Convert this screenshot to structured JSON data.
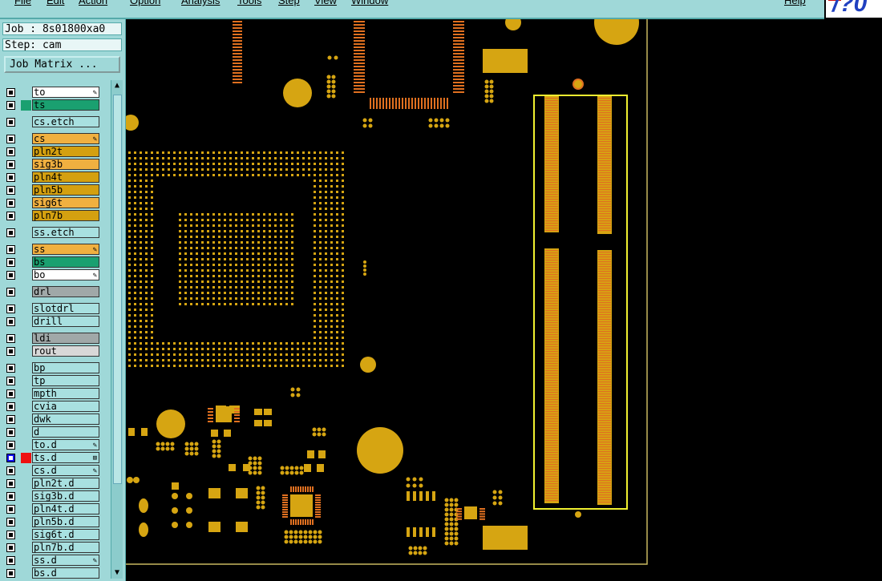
{
  "menu": [
    "File",
    "Edit",
    "Action",
    "Option",
    "Analysis",
    "Tools",
    "Step",
    "View",
    "Window"
  ],
  "help_label": "Help",
  "job": {
    "label": "Job : 8s01800xa0",
    "step": "Step: cam",
    "matrix_button": "Job Matrix ..."
  },
  "colors": {
    "panel": "#9fd8d8",
    "board": "#c9a010",
    "pad": "#d6a512",
    "orange": "#e07020",
    "highlight": "#f0f030",
    "outline": "#c8b860"
  },
  "layers": [
    {
      "name": "to",
      "bg": "#ffffff",
      "gap": false,
      "mark": "✎"
    },
    {
      "name": "ts",
      "bg": "#1aa070",
      "gap": false,
      "swatch": "#1aa070"
    },
    {
      "name": "cs.etch",
      "bg": "#a8e0e0",
      "gap": true
    },
    {
      "name": "cs",
      "bg": "#f0b040",
      "gap": true,
      "mark": "✎"
    },
    {
      "name": "pln2t",
      "bg": "#d4a010",
      "gap": false
    },
    {
      "name": "sig3b",
      "bg": "#f0b040",
      "gap": false
    },
    {
      "name": "pln4t",
      "bg": "#d4a010",
      "gap": false
    },
    {
      "name": "pln5b",
      "bg": "#d4a010",
      "gap": false
    },
    {
      "name": "sig6t",
      "bg": "#f0b040",
      "gap": false
    },
    {
      "name": "pln7b",
      "bg": "#d4a010",
      "gap": false
    },
    {
      "name": "ss.etch",
      "bg": "#a8e0e0",
      "gap": true
    },
    {
      "name": "ss",
      "bg": "#f0b040",
      "gap": true,
      "mark": "✎"
    },
    {
      "name": "bs",
      "bg": "#1aa070",
      "gap": false
    },
    {
      "name": "bo",
      "bg": "#ffffff",
      "gap": false,
      "mark": "✎"
    },
    {
      "name": "drl",
      "bg": "#a0a8a8",
      "gap": true
    },
    {
      "name": "slotdrl",
      "bg": "#a8e0e0",
      "gap": true
    },
    {
      "name": "drill",
      "bg": "#a8e0e0",
      "gap": false
    },
    {
      "name": "ldi",
      "bg": "#a0a8a8",
      "gap": true
    },
    {
      "name": "rout",
      "bg": "#d8d8d8",
      "gap": false
    },
    {
      "name": "bp",
      "bg": "#a8e0e0",
      "gap": true
    },
    {
      "name": "tp",
      "bg": "#a8e0e0",
      "gap": false
    },
    {
      "name": "mpth",
      "bg": "#a8e0e0",
      "gap": false
    },
    {
      "name": "cvia",
      "bg": "#a8e0e0",
      "gap": false
    },
    {
      "name": "dwk",
      "bg": "#a8e0e0",
      "gap": false
    },
    {
      "name": "d",
      "bg": "#a8e0e0",
      "gap": false
    },
    {
      "name": "to.d",
      "bg": "#a8e0e0",
      "gap": false,
      "mark": "✎"
    },
    {
      "name": "ts.d",
      "bg": "#a8e0e0",
      "gap": false,
      "mark": "⊞",
      "swatch": "#ee1010",
      "active": true
    },
    {
      "name": "cs.d",
      "bg": "#a8e0e0",
      "gap": false,
      "mark": "✎"
    },
    {
      "name": "pln2t.d",
      "bg": "#a8e0e0",
      "gap": false
    },
    {
      "name": "sig3b.d",
      "bg": "#a8e0e0",
      "gap": false
    },
    {
      "name": "pln4t.d",
      "bg": "#a8e0e0",
      "gap": false
    },
    {
      "name": "pln5b.d",
      "bg": "#a8e0e0",
      "gap": false
    },
    {
      "name": "sig6t.d",
      "bg": "#a8e0e0",
      "gap": false
    },
    {
      "name": "pln7b.d",
      "bg": "#a8e0e0",
      "gap": false
    },
    {
      "name": "ss.d",
      "bg": "#a8e0e0",
      "gap": false,
      "mark": "✎"
    },
    {
      "name": "bs.d",
      "bg": "#a8e0e0",
      "gap": false
    }
  ]
}
